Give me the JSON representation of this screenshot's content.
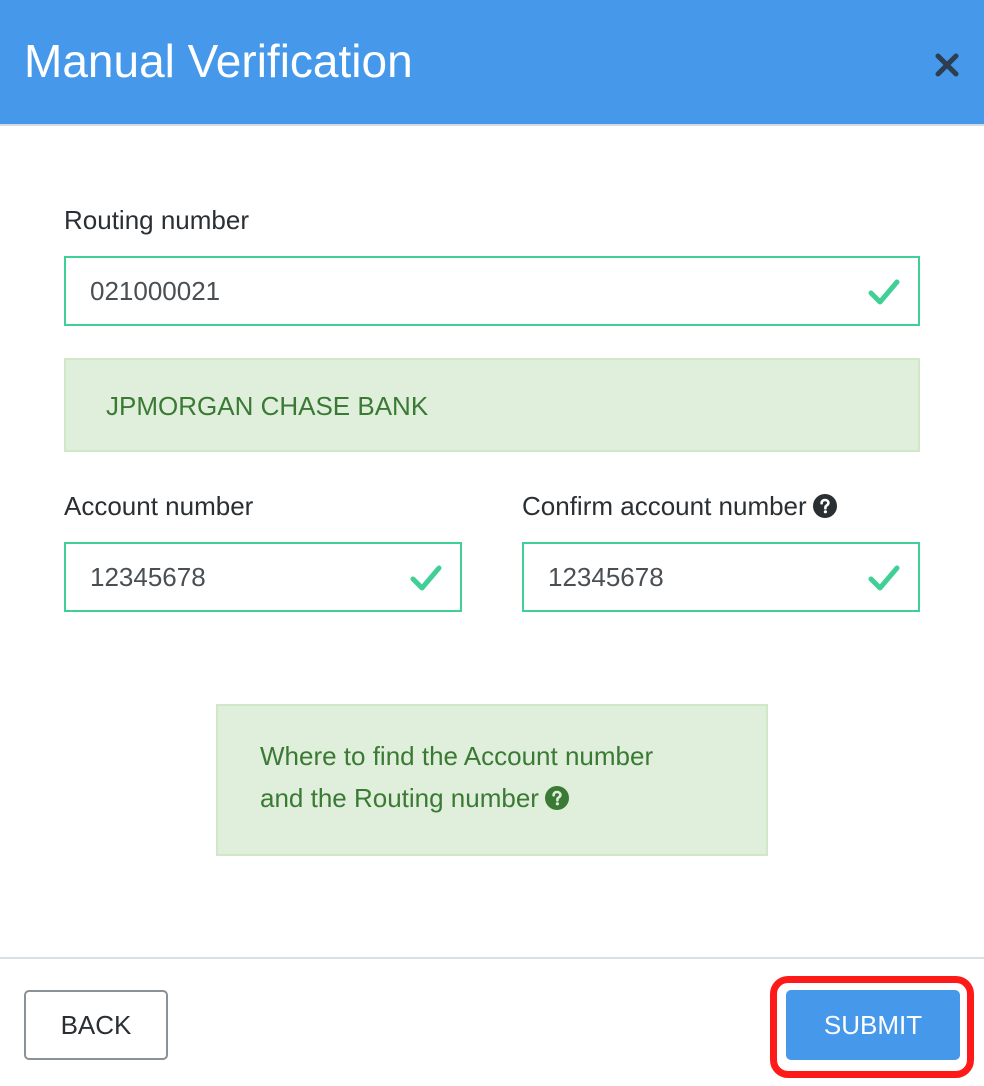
{
  "header": {
    "title": "Manual Verification",
    "close_icon": "close-icon"
  },
  "routing": {
    "label": "Routing number",
    "value": "021000021",
    "status": "valid"
  },
  "bank": {
    "name": "JPMORGAN CHASE BANK"
  },
  "account": {
    "label": "Account number",
    "value": "12345678",
    "status": "valid"
  },
  "confirm_account": {
    "label": "Confirm account number",
    "value": "12345678",
    "status": "valid",
    "help_icon": "question-circle-icon"
  },
  "help": {
    "line1": "Where to find the Account number",
    "line2": "and the Routing number",
    "icon": "question-circle-icon"
  },
  "footer": {
    "back_label": "BACK",
    "submit_label": "SUBMIT",
    "submit_highlighted": true
  },
  "colors": {
    "header": "#4598ea",
    "valid_border": "#3fcf97",
    "success_bg": "#e0efdb",
    "success_text": "#3a7a34",
    "highlight": "#ff1a1a"
  }
}
